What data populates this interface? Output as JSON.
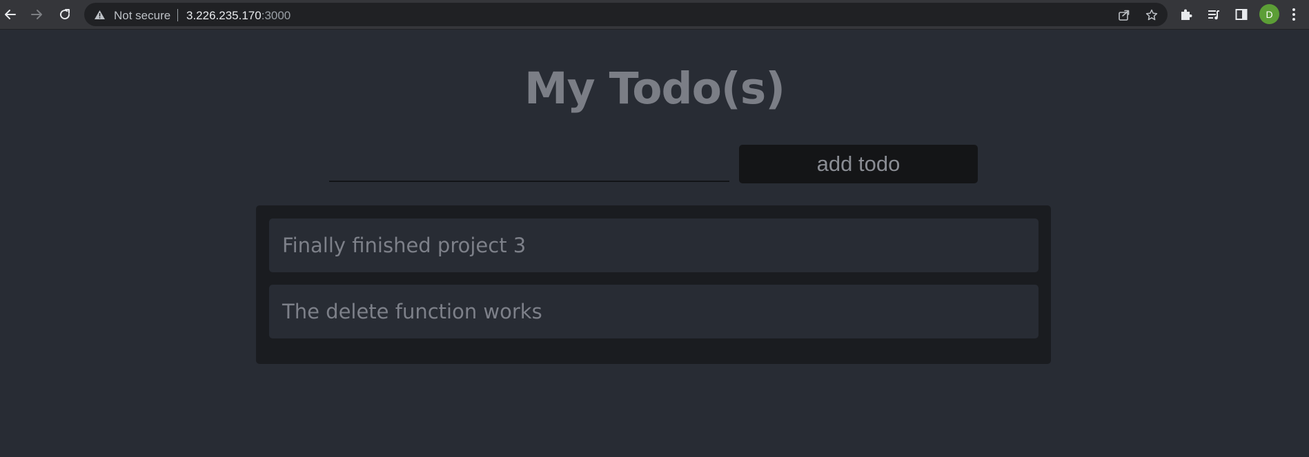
{
  "browser": {
    "security_label": "Not secure",
    "url_host": "3.226.235.170",
    "url_port": ":3000",
    "profile_initial": "D",
    "profile_color": "#5c9e36",
    "icons": {
      "back": "back-arrow-icon",
      "forward": "forward-arrow-icon",
      "reload": "reload-icon",
      "warning": "warning-icon",
      "share": "share-icon",
      "bookmark": "star-icon",
      "extensions": "puzzle-icon",
      "reading_list": "media-list-icon",
      "side_panel": "side-panel-icon",
      "menu": "kebab-menu-icon"
    }
  },
  "app": {
    "title": "My Todo(s)",
    "input": {
      "value": "",
      "placeholder": ""
    },
    "add_button_label": "add todo",
    "todos": [
      {
        "text": "Finally finished project 3"
      },
      {
        "text": "The delete function works"
      }
    ],
    "colors": {
      "background": "#282c34",
      "panel": "#1a1c20",
      "button": "#141517",
      "text": "#7d8089"
    }
  }
}
